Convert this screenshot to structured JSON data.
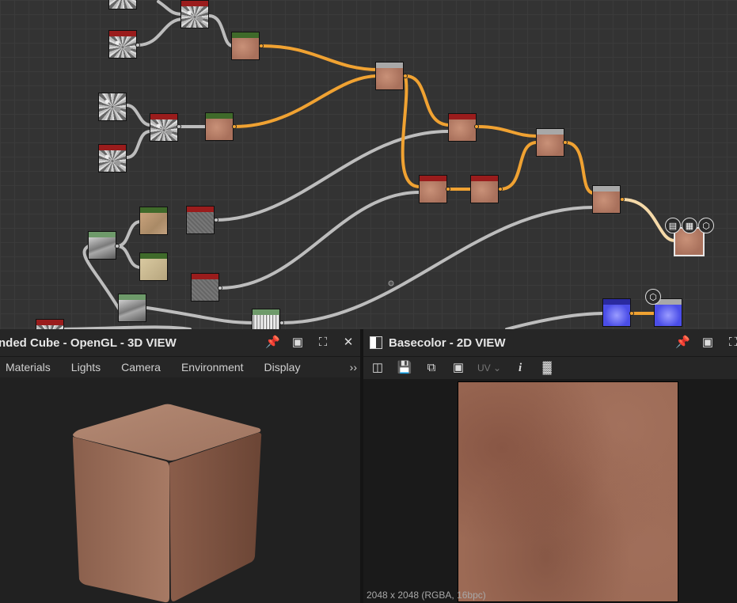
{
  "graph": {
    "output_icons": [
      "document-icon",
      "checker-icon",
      "cube-icon"
    ]
  },
  "view3d": {
    "title": "nded Cube - OpenGL - 3D VIEW",
    "menu": [
      "Materials",
      "Lights",
      "Camera",
      "Environment",
      "Display"
    ],
    "more": "››"
  },
  "view2d": {
    "title": "Basecolor - 2D VIEW",
    "uv_label": "UV",
    "status": "2048 x 2048 (RGBA, 16bpc)"
  },
  "colors": {
    "wire_orange": "#f0a232",
    "wire_gray": "#bdbdbd",
    "node_red": "#9a1c1c",
    "node_green": "#3f6a2a"
  }
}
